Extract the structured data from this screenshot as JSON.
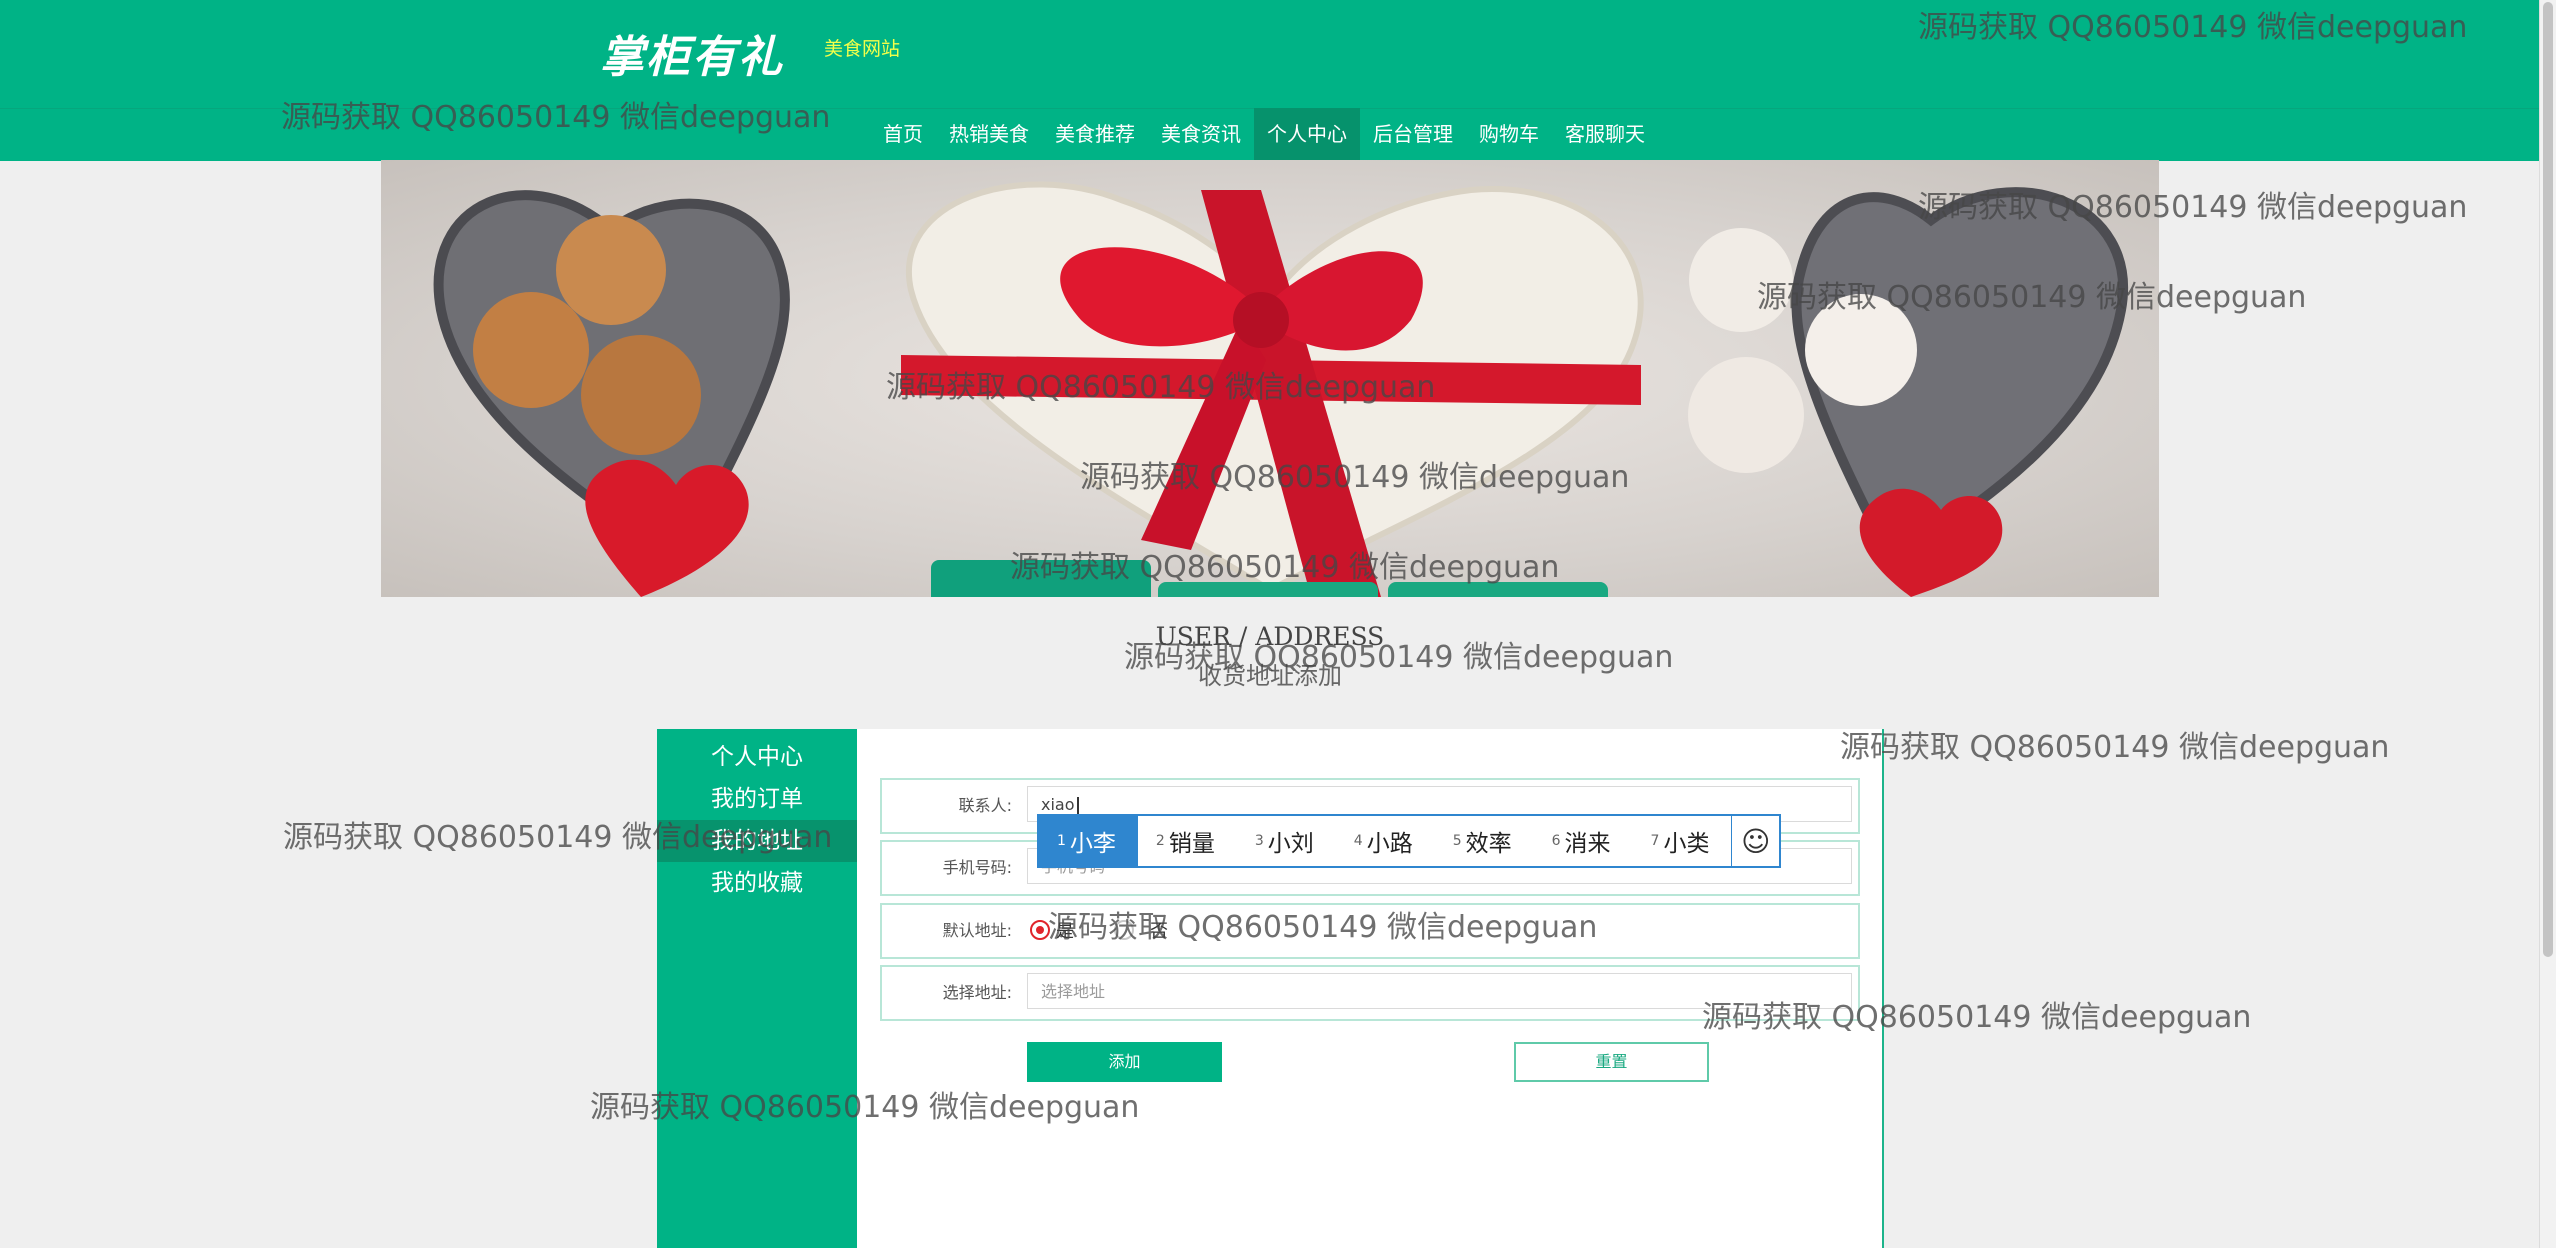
{
  "header": {
    "logo_text": "掌柜有礼",
    "site_subtitle": "美食网站"
  },
  "nav": {
    "items": [
      "首页",
      "热销美食",
      "美食推荐",
      "美食资讯",
      "个人中心",
      "后台管理",
      "购物车",
      "客服聊天"
    ],
    "active": "个人中心"
  },
  "section": {
    "title_en": "USER / ADDRESS",
    "title_cn": "收货地址添加"
  },
  "sidebar": {
    "items": [
      "个人中心",
      "我的订单",
      "我的地址",
      "我的收藏"
    ],
    "selected": "我的地址"
  },
  "form": {
    "contact_label": "联系人:",
    "contact_value": "xiao",
    "phone_label": "手机号码:",
    "phone_placeholder": "手机号码",
    "default_label": "默认地址:",
    "default_yes": "是",
    "default_no": "否",
    "default_selected": "是",
    "address_label": "选择地址:",
    "address_placeholder": "选择地址",
    "add_button": "添加",
    "reset_button": "重置"
  },
  "ime": {
    "candidates": [
      {
        "num": "1",
        "word": "小李"
      },
      {
        "num": "2",
        "word": "销量"
      },
      {
        "num": "3",
        "word": "小刘"
      },
      {
        "num": "4",
        "word": "小路"
      },
      {
        "num": "5",
        "word": "效率"
      },
      {
        "num": "6",
        "word": "消来"
      },
      {
        "num": "7",
        "word": "小类"
      }
    ],
    "selected_index": 1,
    "emoji_glyph": "☺"
  },
  "watermark": {
    "text": "源码获取 QQ86050149 微信deepguan"
  },
  "colors": {
    "brand_green": "#00b386",
    "nav_active": "#06926c",
    "ime_blue": "#2f86cf",
    "radio_red": "#e0252b"
  }
}
